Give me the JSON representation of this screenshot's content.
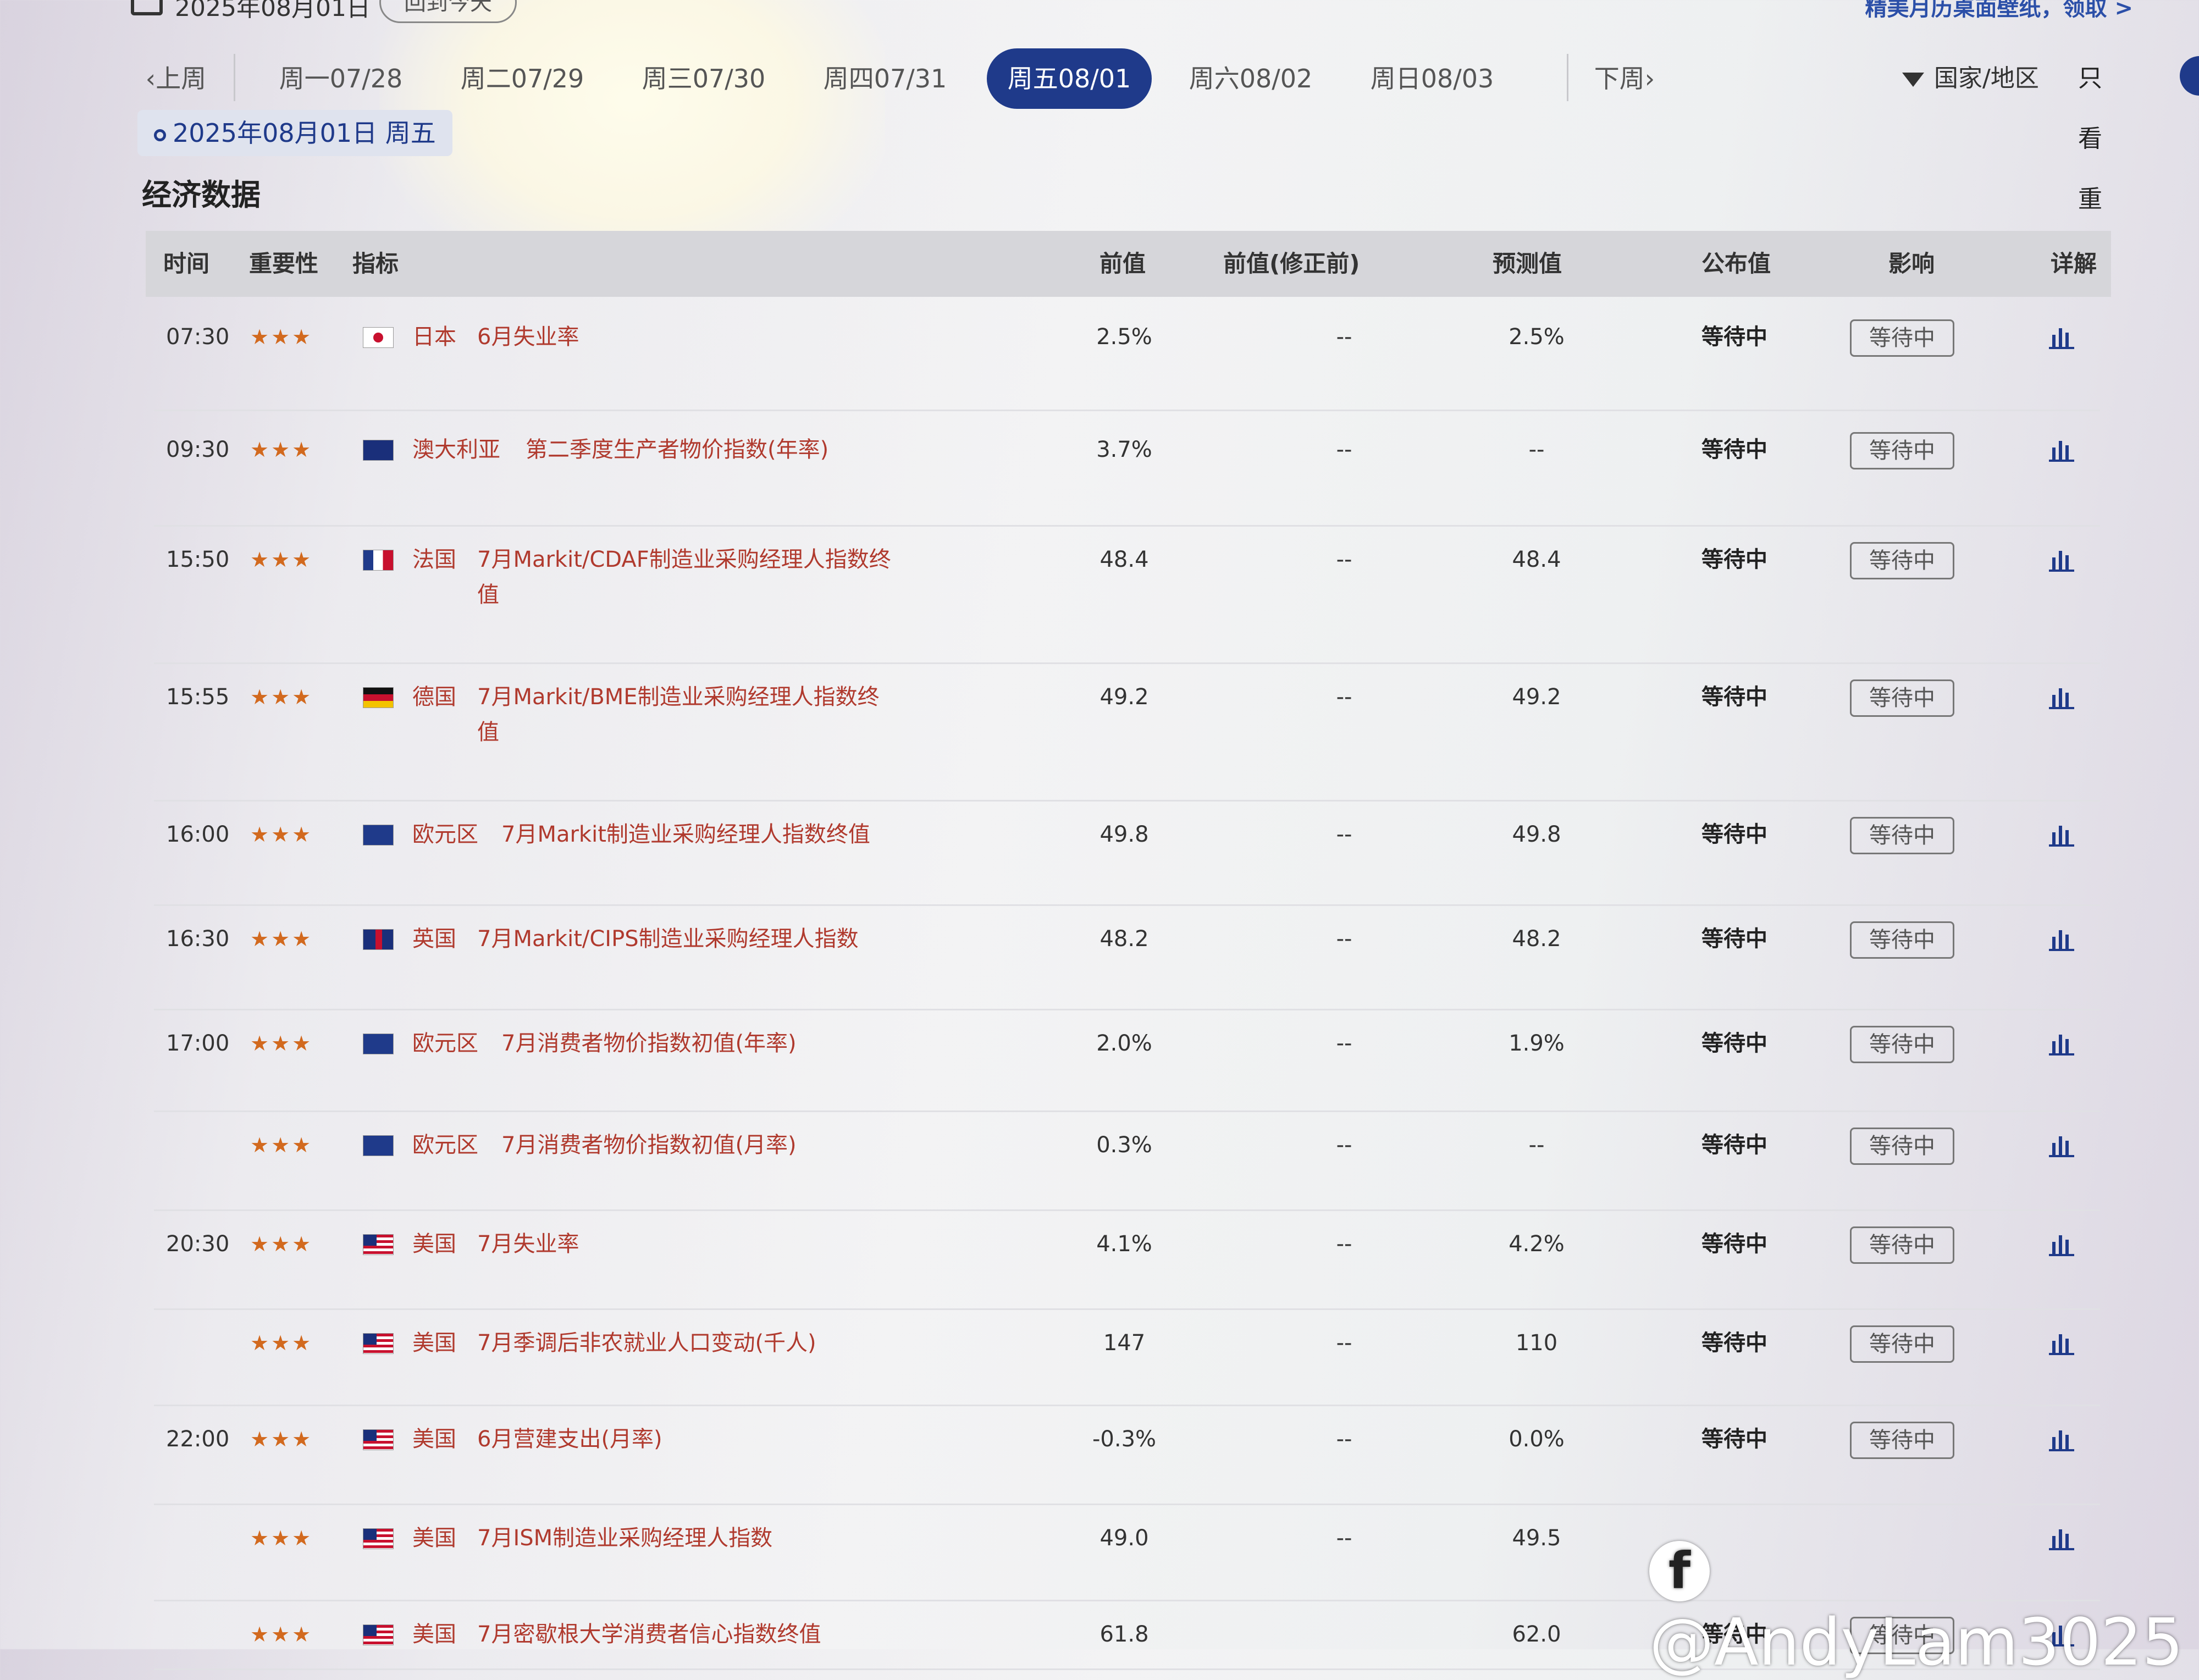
{
  "top": {
    "date": "2025年08月01日",
    "today_button": "回到今天",
    "promo": "精美月历桌面壁纸，领取 >"
  },
  "nav": {
    "prev_week": "上周",
    "days": [
      "周一07/28",
      "周二07/29",
      "周三07/30",
      "周四07/31",
      "周五08/01",
      "周六08/02",
      "周日08/03"
    ],
    "active_index": 4,
    "next_week": "下周",
    "filter_label": "国家/地区",
    "important_only_label": "只看重要",
    "important_only_on": true
  },
  "date_badge": "2025年08月01日 周五",
  "section_title": "经济数据",
  "table": {
    "headers": {
      "time": "时间",
      "importance": "重要性",
      "indicator": "指标",
      "previous": "前值",
      "previous_unrevised": "前值(修正前)",
      "forecast": "预测值",
      "actual": "公布值",
      "impact": "影响",
      "detail": "详解"
    },
    "rows": [
      {
        "time": "07:30",
        "stars": "★★★",
        "flag": "jp",
        "country": "日本",
        "indicator": "6月失业率",
        "indicator2": "",
        "prev": "2.5%",
        "prev_unrev": "--",
        "forecast": "2.5%",
        "actual": "等待中",
        "impact": "等待中"
      },
      {
        "time": "09:30",
        "stars": "★★★",
        "flag": "au",
        "country": "澳大利亚",
        "indicator": "第二季度生产者物价指数(年率)",
        "indicator2": "",
        "prev": "3.7%",
        "prev_unrev": "--",
        "forecast": "--",
        "actual": "等待中",
        "impact": "等待中"
      },
      {
        "time": "15:50",
        "stars": "★★★",
        "flag": "fr",
        "country": "法国",
        "indicator": "7月Markit/CDAF制造业采购经理人指数终",
        "indicator2": "值",
        "prev": "48.4",
        "prev_unrev": "--",
        "forecast": "48.4",
        "actual": "等待中",
        "impact": "等待中"
      },
      {
        "time": "15:55",
        "stars": "★★★",
        "flag": "de",
        "country": "德国",
        "indicator": "7月Markit/BME制造业采购经理人指数终",
        "indicator2": "值",
        "prev": "49.2",
        "prev_unrev": "--",
        "forecast": "49.2",
        "actual": "等待中",
        "impact": "等待中"
      },
      {
        "time": "16:00",
        "stars": "★★★",
        "flag": "eu",
        "country": "欧元区",
        "indicator": "7月Markit制造业采购经理人指数终值",
        "indicator2": "",
        "prev": "49.8",
        "prev_unrev": "--",
        "forecast": "49.8",
        "actual": "等待中",
        "impact": "等待中"
      },
      {
        "time": "16:30",
        "stars": "★★★",
        "flag": "uk",
        "country": "英国",
        "indicator": "7月Markit/CIPS制造业采购经理人指数",
        "indicator2": "",
        "prev": "48.2",
        "prev_unrev": "--",
        "forecast": "48.2",
        "actual": "等待中",
        "impact": "等待中"
      },
      {
        "time": "17:00",
        "stars": "★★★",
        "flag": "eu",
        "country": "欧元区",
        "indicator": "7月消费者物价指数初值(年率)",
        "indicator2": "",
        "prev": "2.0%",
        "prev_unrev": "--",
        "forecast": "1.9%",
        "actual": "等待中",
        "impact": "等待中"
      },
      {
        "time": "",
        "stars": "★★★",
        "flag": "eu",
        "country": "欧元区",
        "indicator": "7月消费者物价指数初值(月率)",
        "indicator2": "",
        "prev": "0.3%",
        "prev_unrev": "--",
        "forecast": "--",
        "actual": "等待中",
        "impact": "等待中"
      },
      {
        "time": "20:30",
        "stars": "★★★",
        "flag": "us",
        "country": "美国",
        "indicator": "7月失业率",
        "indicator2": "",
        "prev": "4.1%",
        "prev_unrev": "--",
        "forecast": "4.2%",
        "actual": "等待中",
        "impact": "等待中"
      },
      {
        "time": "",
        "stars": "★★★",
        "flag": "us",
        "country": "美国",
        "indicator": "7月季调后非农就业人口变动(千人)",
        "indicator2": "",
        "prev": "147",
        "prev_unrev": "--",
        "forecast": "110",
        "actual": "等待中",
        "impact": "等待中"
      },
      {
        "time": "22:00",
        "stars": "★★★",
        "flag": "us",
        "country": "美国",
        "indicator": "6月营建支出(月率)",
        "indicator2": "",
        "prev": "-0.3%",
        "prev_unrev": "--",
        "forecast": "0.0%",
        "actual": "等待中",
        "impact": "等待中"
      },
      {
        "time": "",
        "stars": "★★★",
        "flag": "us",
        "country": "美国",
        "indicator": "7月ISM制造业采购经理人指数",
        "indicator2": "",
        "prev": "49.0",
        "prev_unrev": "--",
        "forecast": "49.5",
        "actual": "",
        "impact": ""
      },
      {
        "time": "",
        "stars": "★★★",
        "flag": "us",
        "country": "美国",
        "indicator": "7月密歇根大学消费者信心指数终值",
        "indicator2": "",
        "prev": "61.8",
        "prev_unrev": "",
        "forecast": "62.0",
        "actual": "等待中",
        "impact": "等待中"
      }
    ]
  },
  "watermark": "@AndyLam3025",
  "colors": {
    "accent": "#1f3a8a",
    "indicator_text": "#b03a2e",
    "stars": "#d2691e"
  }
}
